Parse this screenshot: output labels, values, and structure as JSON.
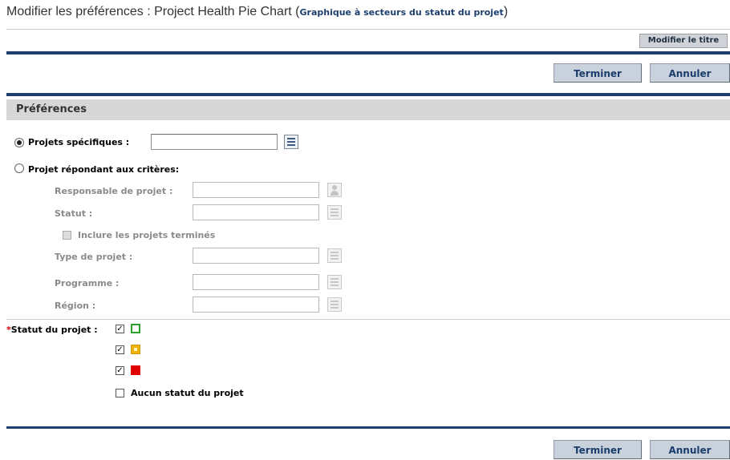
{
  "header": {
    "title": "Modifier les préférences : Project Health Pie Chart",
    "title_paren_open": "(",
    "subtitle": "Graphique à secteurs du statut du projet",
    "title_paren_close": ")",
    "edit_title_button": "Modifier le titre"
  },
  "actions": {
    "finish": "Terminer",
    "cancel": "Annuler"
  },
  "preferences": {
    "section_title": "Préférences",
    "specific_projects": {
      "label": "Projets spécifiques :",
      "selected": true,
      "value": ""
    },
    "criteria_projects": {
      "label": "Projet répondant aux critères:",
      "selected": false,
      "project_manager": {
        "label": "Responsable de projet :",
        "value": ""
      },
      "status": {
        "label": "Statut :",
        "value": ""
      },
      "include_closed": {
        "label": "Inclure les projets terminés",
        "checked": false
      },
      "project_type": {
        "label": "Type de projet :",
        "value": ""
      },
      "program": {
        "label": "Programme :",
        "value": ""
      },
      "region": {
        "label": "Région :",
        "value": ""
      }
    },
    "project_status": {
      "required_mark": "*",
      "label": "Statut du projet :",
      "options": [
        {
          "checked": true,
          "color": "#2ea02e",
          "style": "outline"
        },
        {
          "checked": true,
          "color": "#f0b400",
          "style": "filled-dot"
        },
        {
          "checked": true,
          "color": "#e00000",
          "style": "filled"
        }
      ],
      "none_label": "Aucun statut du projet",
      "none_checked": false
    }
  },
  "colors": {
    "accent": "#1f3f6e",
    "section_bg": "#d7d7d7",
    "button_bg": "#c9d2dc"
  }
}
